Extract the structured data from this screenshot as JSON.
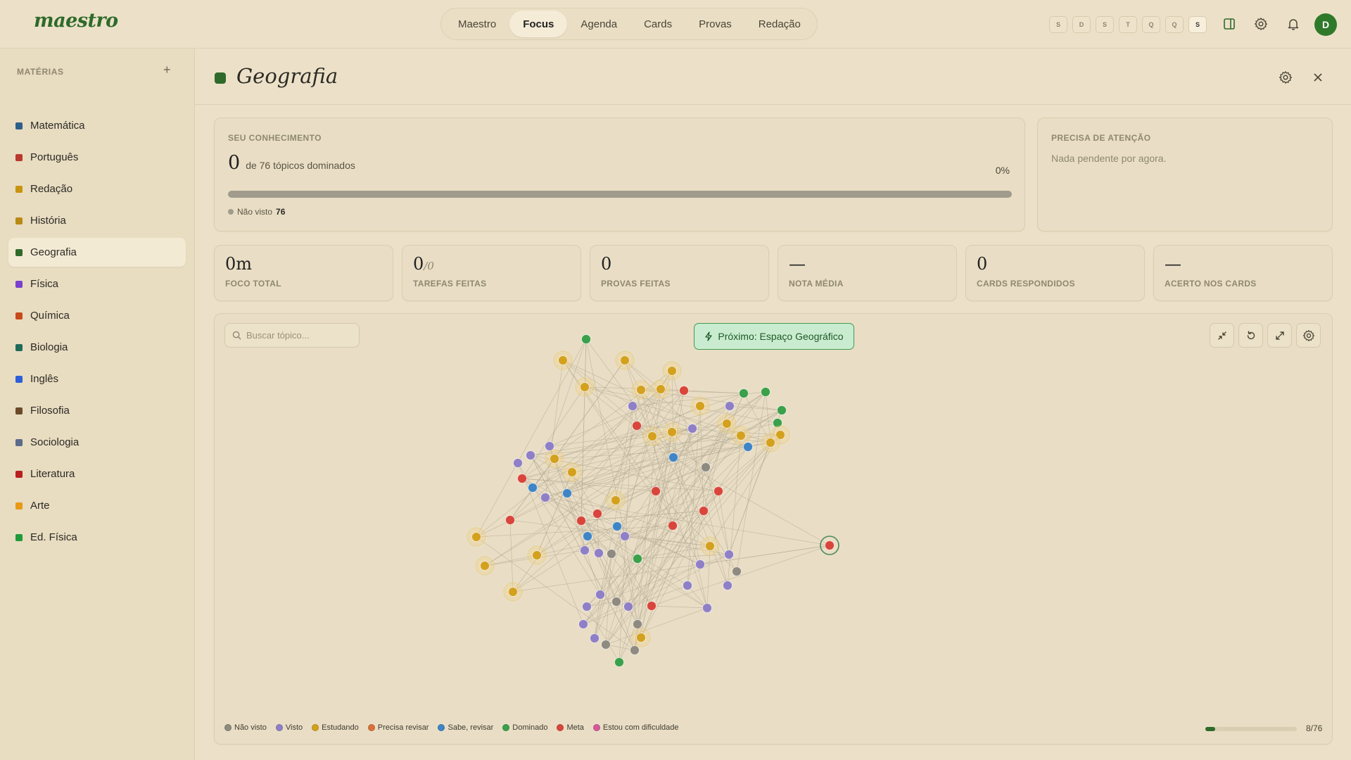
{
  "app": {
    "logo": "maestro"
  },
  "nav": {
    "tabs": [
      "Maestro",
      "Focus",
      "Agenda",
      "Cards",
      "Provas",
      "Redação"
    ],
    "active_index": 1
  },
  "week_days": [
    "S",
    "D",
    "S",
    "T",
    "Q",
    "Q",
    "S"
  ],
  "today_index": 6,
  "user": {
    "initial": "D"
  },
  "sidebar": {
    "heading": "MATÉRIAS",
    "add_label": "+",
    "items": [
      {
        "label": "Matemática",
        "color": "#2e5f8a"
      },
      {
        "label": "Português",
        "color": "#b8392c"
      },
      {
        "label": "Redação",
        "color": "#c89410"
      },
      {
        "label": "História",
        "color": "#b88a14"
      },
      {
        "label": "Geografia",
        "color": "#2f6a2a"
      },
      {
        "label": "Física",
        "color": "#7b3fd0"
      },
      {
        "label": "Química",
        "color": "#c84a1a"
      },
      {
        "label": "Biologia",
        "color": "#1f6b5a"
      },
      {
        "label": "Inglês",
        "color": "#2d5fd8"
      },
      {
        "label": "Filosofia",
        "color": "#6b4a2a"
      },
      {
        "label": "Sociologia",
        "color": "#5a6b8a"
      },
      {
        "label": "Literatura",
        "color": "#b81f1f"
      },
      {
        "label": "Arte",
        "color": "#e89a14"
      },
      {
        "label": "Ed. Física",
        "color": "#1f9a3a"
      }
    ],
    "active_index": 4
  },
  "page": {
    "title": "Geografia",
    "color": "#2f6a2a"
  },
  "knowledge": {
    "heading": "SEU CONHECIMENTO",
    "mastered": "0",
    "mastered_text": "de 76 tópicos dominados",
    "percent": "0%",
    "progress_fraction": 0,
    "not_seen_label": "Não visto",
    "not_seen_count": "76"
  },
  "attention": {
    "heading": "PRECISA DE ATENÇÃO",
    "message": "Nada pendente por agora."
  },
  "stats": [
    {
      "value": "0m",
      "suffix": "",
      "label": "FOCO TOTAL"
    },
    {
      "value": "0",
      "suffix": "/0",
      "label": "TAREFAS FEITAS"
    },
    {
      "value": "0",
      "suffix": "",
      "label": "PROVAS FEITAS"
    },
    {
      "value": "—",
      "suffix": "",
      "label": "NOTA MÉDIA"
    },
    {
      "value": "0",
      "suffix": "",
      "label": "CARDS RESPONDIDOS"
    },
    {
      "value": "—",
      "suffix": "",
      "label": "ACERTO NOS CARDS"
    }
  ],
  "graph": {
    "search_placeholder": "Buscar tópico...",
    "next_label": "Próximo: Espaço Geográfico",
    "legend": [
      {
        "label": "Não visto",
        "color": "#8f8a80"
      },
      {
        "label": "Visto",
        "color": "#8e7fc6"
      },
      {
        "label": "Estudando",
        "color": "#d4a11e"
      },
      {
        "label": "Precisa revisar",
        "color": "#d9713a"
      },
      {
        "label": "Sabe, revisar",
        "color": "#3d85c6"
      },
      {
        "label": "Dominado",
        "color": "#3aa04a"
      },
      {
        "label": "Meta",
        "color": "#d9453a"
      },
      {
        "label": "Estou com dificuldade",
        "color": "#d65a9a"
      }
    ],
    "progress_text": "8/76",
    "progress_fraction": 0.105
  }
}
